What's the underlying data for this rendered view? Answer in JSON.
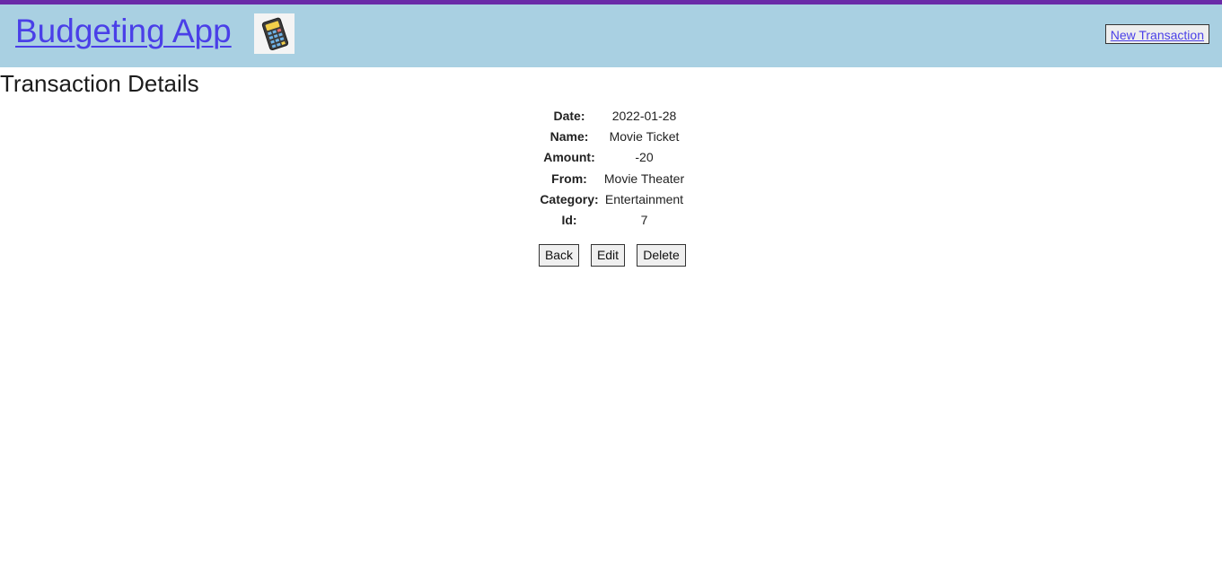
{
  "header": {
    "app_title": "Budgeting App",
    "logo_icon": "calculator-icon",
    "new_transaction_label": "New Transaction",
    "accent_top_bar": "#6a2aa8",
    "nav_background": "#a9d0e2",
    "link_color": "#4a3fe8"
  },
  "main": {
    "title": "Transaction Details",
    "details": [
      {
        "label": "Date:",
        "value": "2022-01-28"
      },
      {
        "label": "Name:",
        "value": "Movie Ticket"
      },
      {
        "label": "Amount:",
        "value": "-20"
      },
      {
        "label": "From:",
        "value": "Movie Theater"
      },
      {
        "label": "Category:",
        "value": "Entertainment"
      },
      {
        "label": "Id:",
        "value": "7"
      }
    ],
    "actions": {
      "back_label": "Back",
      "edit_label": "Edit",
      "delete_label": "Delete"
    }
  }
}
